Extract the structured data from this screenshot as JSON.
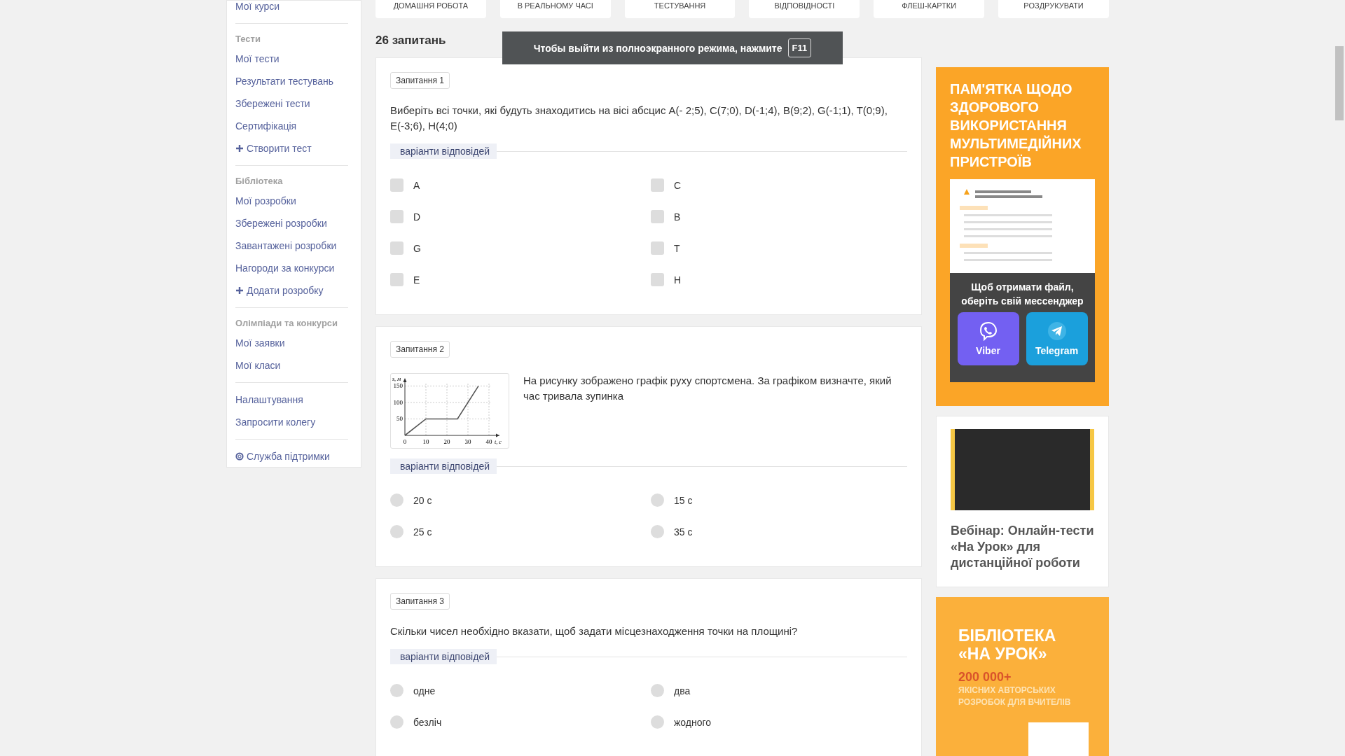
{
  "top_tabs": [
    {
      "label": "ДОМАШНЯ РОБОТА"
    },
    {
      "label": "В РЕАЛЬНОМУ ЧАСІ"
    },
    {
      "label": "ТЕСТУВАННЯ"
    },
    {
      "label": "ВІДПОВІДНОСТІ"
    },
    {
      "label": "ФЛЕШ-КАРТКИ"
    },
    {
      "label": "РОЗДРУКУВАТИ"
    }
  ],
  "sidebar": {
    "sections": [
      {
        "items": [
          {
            "label": "Мої курси",
            "kind": "link"
          }
        ]
      },
      {
        "heading": "Тести",
        "items": [
          {
            "label": "Мої тести",
            "kind": "link"
          },
          {
            "label": "Результати тестувань",
            "kind": "link"
          },
          {
            "label": "Збережені тести",
            "kind": "link"
          },
          {
            "label": "Сертифікація",
            "kind": "link"
          },
          {
            "label": "Створити тест",
            "kind": "add"
          }
        ]
      },
      {
        "heading": "Бібліотека",
        "items": [
          {
            "label": "Мої розробки",
            "kind": "link"
          },
          {
            "label": "Збережені розробки",
            "kind": "link"
          },
          {
            "label": "Завантажені розробки",
            "kind": "link"
          },
          {
            "label": "Нагороди за конкурси",
            "kind": "link"
          },
          {
            "label": "Додати розробку",
            "kind": "add"
          }
        ]
      },
      {
        "heading": "Олімпіади та конкурси",
        "items": [
          {
            "label": "Мої заявки",
            "kind": "link"
          },
          {
            "label": "Мої класи",
            "kind": "link"
          }
        ]
      },
      {
        "items": [
          {
            "label": "Налаштування",
            "kind": "link"
          },
          {
            "label": "Запросити колегу",
            "kind": "link"
          }
        ]
      },
      {
        "items": [
          {
            "label": "Служба підтримки",
            "kind": "support"
          }
        ]
      }
    ]
  },
  "count": "26 запитань",
  "fullscreen_notice": {
    "text": "Чтобы выйти из полноэкранного режима, нажмите",
    "key": "F11"
  },
  "questions": [
    {
      "label": "Запитання 1",
      "text": "Виберіть всі точки, які будуть знаходитись на вісі абсцис A(- 2;5), C(7;0), D(-1;4), B(9;2), G(-1;1), T(0;9), E(-3;6), H(4;0)",
      "answers_label": "варіанти відповідей",
      "kind": "checkbox",
      "options": [
        {
          "label": "A",
          "checked": false
        },
        {
          "label": "C",
          "checked": false
        },
        {
          "label": "D",
          "checked": false
        },
        {
          "label": "B",
          "checked": false
        },
        {
          "label": "G",
          "checked": false
        },
        {
          "label": "T",
          "checked": false
        },
        {
          "label": "E",
          "checked": false
        },
        {
          "label": "H",
          "checked": false
        }
      ]
    },
    {
      "label": "Запитання 2",
      "text": "На рисунку зображено графік руху спортсмена. За графіком визначте, який час тривала зупинка",
      "chart_data": {
        "type": "line",
        "xlabel": "t, c",
        "ylabel": "s, м",
        "x": [
          0,
          10,
          25,
          35
        ],
        "series": [
          {
            "color": "#555555",
            "values": [
              0,
              50,
              50,
              150
            ]
          }
        ],
        "xlim": [
          0,
          45
        ],
        "ylim": [
          0,
          170
        ],
        "grid": true,
        "xticks": [
          0,
          10,
          20,
          30,
          40
        ],
        "yticks": [
          50,
          100,
          150
        ]
      },
      "answers_label": "варіанти відповідей",
      "kind": "radio",
      "options": [
        {
          "label": "20 с",
          "checked": false
        },
        {
          "label": "15 с",
          "checked": false
        },
        {
          "label": "25 с",
          "checked": false
        },
        {
          "label": "35 с",
          "checked": false
        }
      ]
    },
    {
      "label": "Запитання 3",
      "text": "Скільки чисел необхідно вказати, щоб задати місцезнаходження точки на площині?",
      "answers_label": "варіанти відповідей",
      "kind": "radio",
      "options": [
        {
          "label": "одне",
          "checked": false
        },
        {
          "label": "два",
          "checked": false
        },
        {
          "label": "безліч",
          "checked": false
        },
        {
          "label": "жодного",
          "checked": false
        }
      ]
    }
  ],
  "ads": {
    "memo": {
      "title": "ПАМ'ЯТКА ЩОДО ЗДОРОВОГО ВИКОРИСТАННЯ МУЛЬТИМЕДІЙНИХ ПРИСТРОЇВ",
      "prompt": "Щоб отримати файл, оберіть свій мессенджер",
      "buttons": [
        {
          "label": "Viber",
          "kind": "viber"
        },
        {
          "label": "Telegram",
          "kind": "telegram"
        }
      ]
    },
    "webinar": {
      "title": "Вебінар: Онлайн-тести «На Урок» для дистанційної роботи"
    },
    "library": {
      "title": "БІБЛІОТЕКА «НА УРОК»",
      "highlight": "200 000+",
      "subtitle": "ЯКІСНИХ АВТОРСЬКИХ РОЗРОБОК ДЛЯ ВЧИТЕЛІВ"
    }
  }
}
